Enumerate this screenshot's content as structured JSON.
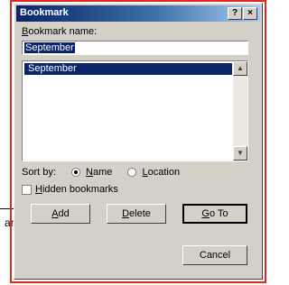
{
  "background_doc": {
    "text_fragment": "ar"
  },
  "dialog": {
    "title": "Bookmark",
    "help_glyph": "?",
    "close_glyph": "×",
    "name_label_key": "B",
    "name_label_rest": "ookmark name:",
    "name_value": "September",
    "list_items": [
      "September"
    ],
    "sort_label": "Sort by:",
    "sort_options": [
      {
        "key": "N",
        "rest": "ame",
        "selected": true
      },
      {
        "key": "L",
        "rest": "ocation",
        "selected": false
      }
    ],
    "hidden_key": "H",
    "hidden_rest": "idden bookmarks",
    "hidden_checked": false,
    "buttons": {
      "add": {
        "key": "A",
        "rest": "dd"
      },
      "delete": {
        "key": "D",
        "rest": "elete"
      },
      "goto": {
        "key": "G",
        "rest": "o To"
      },
      "cancel": "Cancel"
    }
  },
  "colors": {
    "title_gradient_start": "#0a246a",
    "title_gradient_end": "#a6caf0",
    "face": "#d4d0c8",
    "selection": "#0a246a",
    "highlight_frame": "#e0281e"
  },
  "icons": [
    "help-icon",
    "close-icon",
    "scroll-up-icon",
    "scroll-down-icon"
  ]
}
